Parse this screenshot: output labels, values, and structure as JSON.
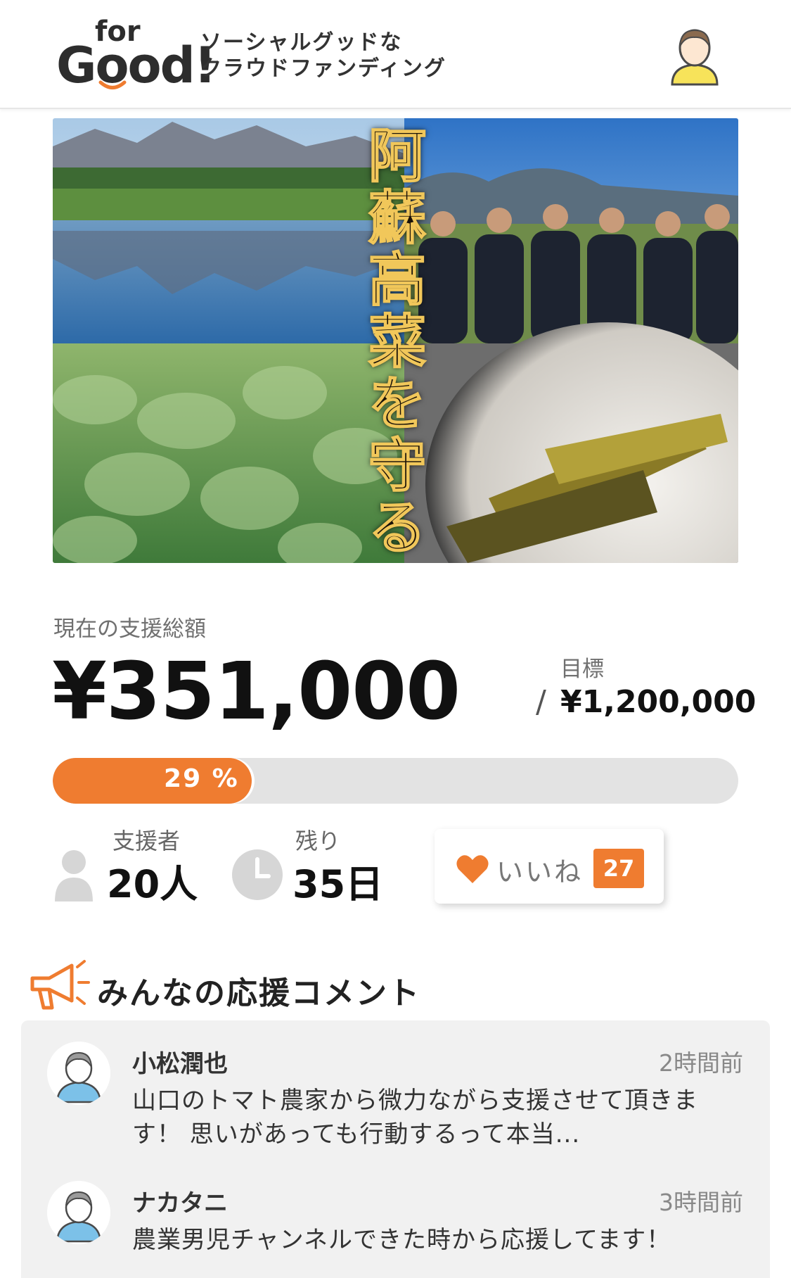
{
  "header": {
    "logo_for": "for",
    "logo_good": "Good!",
    "tagline_line1": "ソーシャルグッドな",
    "tagline_line2": "クラウドファンディング",
    "avatar_icon": "user-avatar-icon"
  },
  "hero": {
    "title": "阿蘇高菜を守る"
  },
  "funding": {
    "current_label": "現在の支援総額",
    "current_amount": "¥351,000",
    "goal_label": "目標",
    "goal_slash": "/",
    "goal_amount": "¥1,200,000",
    "progress_percent": 29,
    "progress_text": "29 %",
    "accent_color": "#ef7c30"
  },
  "stats": {
    "supporters_label": "支援者",
    "supporters_value": "20人",
    "remaining_label": "残り",
    "remaining_value": "35日",
    "like_label": "いいね",
    "like_count": "27"
  },
  "comments": {
    "title": "みんなの応援コメント",
    "items": [
      {
        "name": "小松潤也",
        "time": "2時間前",
        "text_line1": "山口のトマト農家から微力ながら支援させて頂きま",
        "text_line2": "す！ 思いがあっても行動するって本当..."
      },
      {
        "name": "ナカタニ",
        "time": "3時間前",
        "text_line1": "農業男児チャンネルできた時から応援してます！"
      }
    ]
  }
}
